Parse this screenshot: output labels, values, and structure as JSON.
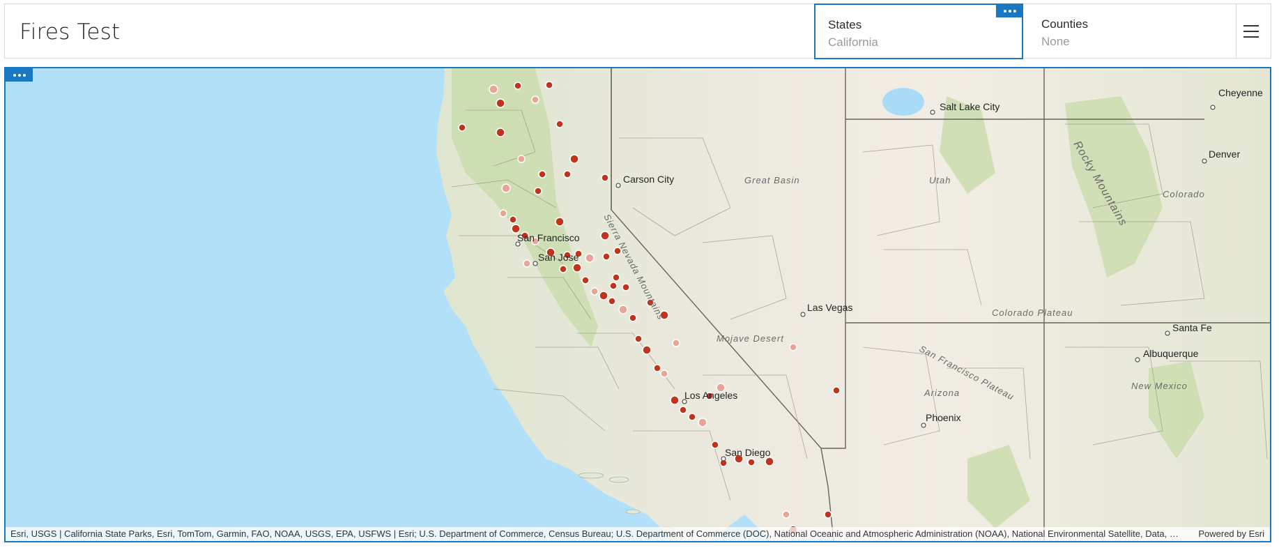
{
  "app": {
    "title": "Fires Test"
  },
  "selectors": {
    "states": {
      "label": "States",
      "value": "California"
    },
    "counties": {
      "label": "Counties",
      "value": "None"
    }
  },
  "icons": {
    "widget_menu": "more-dots-icon",
    "hamburger": "hamburger-menu-icon",
    "fire": "fire-icon"
  },
  "colors": {
    "accent": "#1a78c2",
    "fire": "#c0341d",
    "water": "#a9dbf6"
  },
  "map": {
    "cities": [
      "Salt Lake City",
      "Cheyenne",
      "Denver",
      "Carson City",
      "San Francisco",
      "San Jose",
      "Las Vegas",
      "Santa Fe",
      "Albuquerque",
      "Phoenix",
      "Los Angeles",
      "San Diego"
    ],
    "regions": [
      "Great Basin",
      "Utah",
      "Colorado",
      "Mojave Desert",
      "Colorado Plateau",
      "San Francisco Plateau",
      "Arizona",
      "New Mexico",
      "Rocky Mountains",
      "Sierra Nevada Mountains"
    ],
    "attribution": "Esri, USGS | California State Parks, Esri, TomTom, Garmin, FAO, NOAA, USGS, EPA, USFWS | Esri; U.S. Department of Commerce, Census Bureau; U.S. Department of Commerce (DOC), National Oceanic and Atmospheric Administration (NOAA), National Environmental Satellite, Data, and Information Service (NESDIS)",
    "powered_by": "Powered by Esri"
  }
}
